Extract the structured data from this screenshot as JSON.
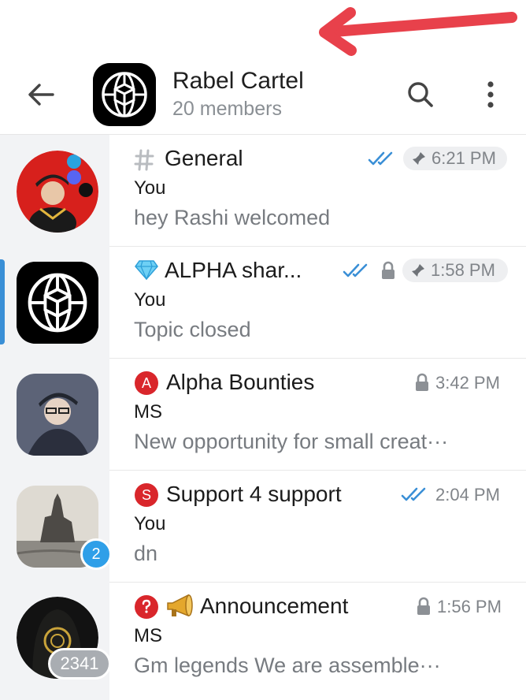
{
  "header": {
    "title": "Rabel Cartel",
    "subtitle": "20 members"
  },
  "topics": [
    {
      "title": "General",
      "sender": "You",
      "message": "hey Rashi welcomed",
      "time": "6:21 PM",
      "pinned": true,
      "read": true,
      "locked": false,
      "icon": "hash-icon"
    },
    {
      "title": "ALPHA shar...",
      "sender": "You",
      "message": "Topic closed",
      "time": "1:58 PM",
      "pinned": true,
      "read": true,
      "locked": true,
      "icon": "diamond-icon"
    },
    {
      "title": "Alpha Bounties",
      "sender": "MS",
      "message": "New opportunity for small creat···",
      "time": "3:42 PM",
      "pinned": false,
      "read": false,
      "locked": true,
      "icon": "letter-a-icon",
      "icon_letter": "A"
    },
    {
      "title": "Support 4 support",
      "sender": "You",
      "message": "dn",
      "time": "2:04 PM",
      "pinned": false,
      "read": true,
      "locked": false,
      "icon": "letter-s-icon",
      "icon_letter": "S"
    },
    {
      "title": "Announcement",
      "sender": "MS",
      "message": "Gm legends   We are assemble···",
      "time": "1:56 PM",
      "pinned": false,
      "read": false,
      "locked": true,
      "icon": "megaphone-icon"
    }
  ],
  "sidebar": {
    "badges": [
      "2",
      "2341"
    ],
    "selected_index": 1
  },
  "colors": {
    "accent": "#3a8fd6",
    "annotation_arrow": "#e8414b",
    "badge_blue": "#2f9fe8",
    "badge_gray": "#a9adb2"
  }
}
